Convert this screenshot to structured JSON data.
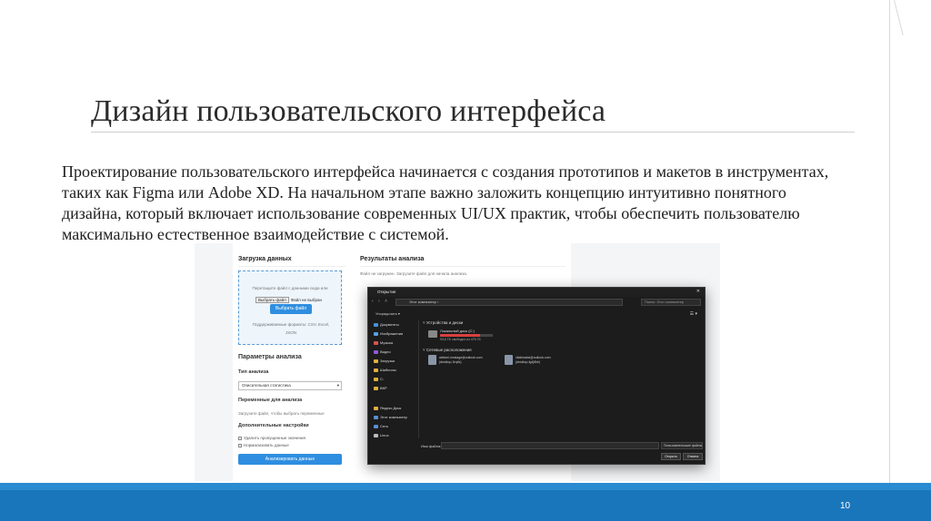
{
  "slide": {
    "title": "Дизайн пользовательского интерфейса",
    "body": "Проектирование пользовательского интерфейса начинается с создания прототипов и макетов в инструментах, таких как Figma или Adobe XD. На начальном этапе важно заложить концепцию интуитивно понятного дизайна, который включает использование современных UI/UX практик, чтобы обеспечить пользователю максимально естественное взаимодействие с системой.",
    "page_number": "10"
  },
  "screenshot": {
    "upload": {
      "heading": "Загрузка данных",
      "hint": "Перетащите файл с данными сюда или",
      "choose_label": "Выбрать файл",
      "no_file": "Файл не выбран",
      "button": "Выбрать файл",
      "formats_1": "Поддерживаемые форматы: CSV, Excel,",
      "formats_2": "JSON"
    },
    "params": {
      "heading": "Параметры анализа",
      "type_label": "Тип анализа",
      "type_value": "Описательная статистика",
      "vars_label": "Переменные для анализа",
      "vars_note": "Загрузите файл, чтобы выбрать переменные",
      "extra_label": "Дополнительные настройки",
      "opt_1": "Удалить пропущенные значения",
      "opt_2": "Нормализовать данные",
      "action": "Анализировать данные"
    },
    "results": {
      "heading": "Результаты анализа",
      "note": "Файл не загружен. Загрузите файл для начала анализа."
    },
    "dialog": {
      "title": "Открытие",
      "close": "✕",
      "nav": "‹ › ˄",
      "address": "Этот компьютер  ›",
      "search": "Поиск: Этот компьютер",
      "toolbar": "Упорядочить ▾",
      "view": "☰ ▾",
      "sidebar": [
        {
          "label": "Документы",
          "color": "#4a90d9"
        },
        {
          "label": "Изображения",
          "color": "#5aa0e0"
        },
        {
          "label": "Музыка",
          "color": "#d9534f"
        },
        {
          "label": "Видео",
          "color": "#8e5bd9"
        },
        {
          "label": "Загрузки",
          "color": "#e0b040"
        },
        {
          "label": "Шаблоны",
          "color": "#e0b040"
        },
        {
          "label": "C:",
          "color": "#e0b040"
        },
        {
          "label": "ВКР",
          "color": "#e0b040"
        },
        {
          "label": "Яндекс Диск",
          "color": "#e0b040"
        },
        {
          "label": "Этот компьютер",
          "color": "#5a8fd0"
        },
        {
          "label": "Сеть",
          "color": "#5a8fd0"
        },
        {
          "label": "Linux",
          "color": "#bbbbbb"
        }
      ],
      "group_devices": "˅ Устройства и диски",
      "drive_name": "Локальный диск (C:)",
      "drive_used_fraction": 0.75,
      "drive_free": "93,6 ГБ свободно из 475 ГБ",
      "group_network": "˅ Сетевые расположения",
      "net_1_line1": "aleksei.mosiaga@outlook.com",
      "net_1_line2": "(desktop-3rq4k)",
      "net_2_line1": "vitalimaksi@outlook.com",
      "net_2_line2": "(desktop-fg4j5kb)",
      "filename_label": "Имя файла:",
      "file_type": "Пользовательские файлы",
      "open": "Открыть",
      "cancel": "Отмена"
    }
  }
}
